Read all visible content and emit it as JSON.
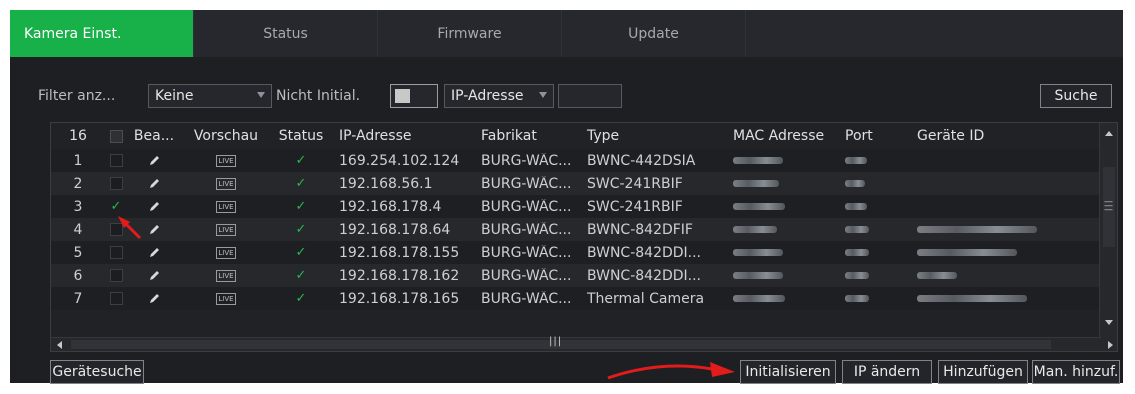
{
  "tabs": [
    {
      "label": "Kamera Einst.",
      "active": true
    },
    {
      "label": "Status",
      "active": false
    },
    {
      "label": "Firmware",
      "active": false
    },
    {
      "label": "Update",
      "active": false
    }
  ],
  "filter": {
    "label": "Filter anz...",
    "select_value": "Keine",
    "not_initialized_label": "Nicht Initial.",
    "ip_select_value": "IP-Adresse",
    "search_value": "",
    "search_button": "Suche"
  },
  "table": {
    "count": "16",
    "headers": {
      "edit": "Bea...",
      "preview": "Vorschau",
      "status": "Status",
      "ip": "IP-Adresse",
      "manufacturer": "Fabrikat",
      "type": "Type",
      "mac": "MAC Adresse",
      "port": "Port",
      "device_id": "Geräte ID"
    },
    "live_label": "LIVE",
    "rows": [
      {
        "no": "1",
        "checked": false,
        "ip": "169.254.102.124",
        "manufacturer": "BURG-WÄC...",
        "type": "BWNC-442DSIA",
        "id_blur": 0
      },
      {
        "no": "2",
        "checked": false,
        "ip": "192.168.56.1",
        "manufacturer": "BURG-WÄC...",
        "type": "SWC-241RBIF",
        "id_blur": 0
      },
      {
        "no": "3",
        "checked": true,
        "ip": "192.168.178.4",
        "manufacturer": "BURG-WÄC...",
        "type": "SWC-241RBIF",
        "id_blur": 0
      },
      {
        "no": "4",
        "checked": false,
        "ip": "192.168.178.64",
        "manufacturer": "BURG-WÄC...",
        "type": "BWNC-842DFIF",
        "id_blur": 120
      },
      {
        "no": "5",
        "checked": false,
        "ip": "192.168.178.155",
        "manufacturer": "BURG-WÄC...",
        "type": "BWNC-842DDI...",
        "id_blur": 100
      },
      {
        "no": "6",
        "checked": false,
        "ip": "192.168.178.162",
        "manufacturer": "BURG-WÄC...",
        "type": "BWNC-842DDI...",
        "id_blur": 40
      },
      {
        "no": "7",
        "checked": false,
        "ip": "192.168.178.165",
        "manufacturer": "BURG-WÄC...",
        "type": "Thermal Camera",
        "id_blur": 110
      }
    ]
  },
  "buttons": {
    "device_search": "Gerätesuche",
    "initialize": "Initialisieren",
    "change_ip": "IP ändern",
    "add": "Hinzufügen",
    "manual_add": "Man. hinzuf."
  },
  "colors": {
    "accent": "#17b049",
    "annotation": "#e21b1b"
  }
}
